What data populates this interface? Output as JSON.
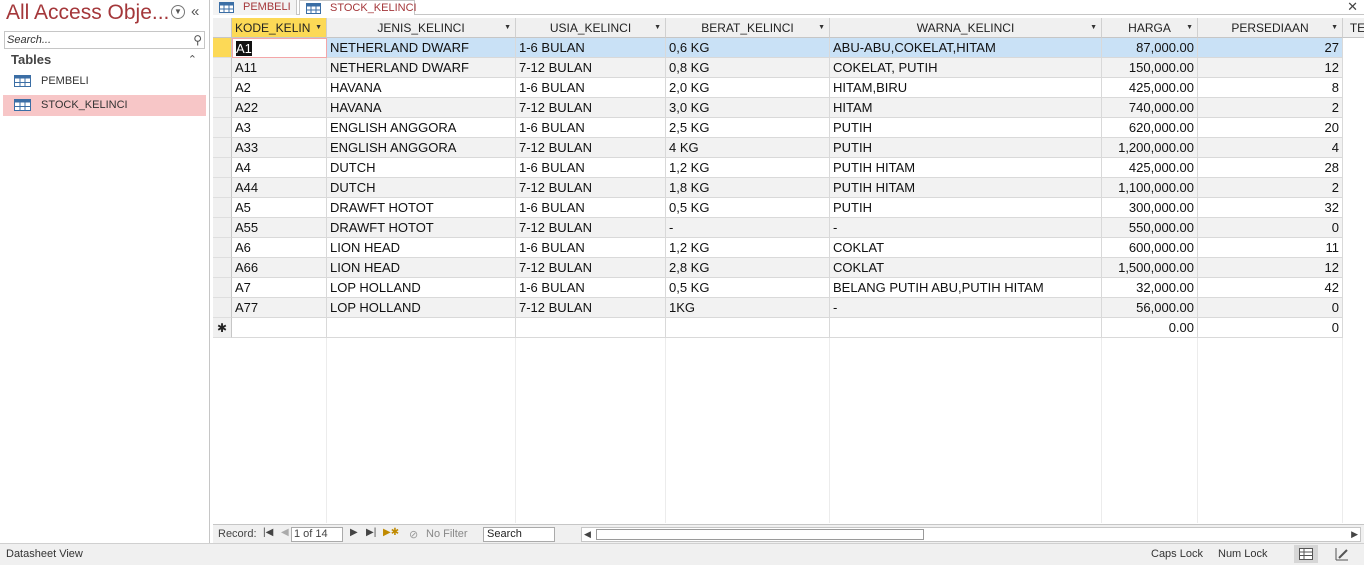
{
  "nav": {
    "title": "All Access Obje...",
    "search_placeholder": "Search...",
    "group_label": "Tables",
    "items": [
      {
        "label": "PEMBELI",
        "selected": false
      },
      {
        "label": "STOCK_KELINCI",
        "selected": true
      }
    ]
  },
  "tabs": [
    {
      "label": "PEMBELI",
      "active": false
    },
    {
      "label": "STOCK_KELINCI",
      "active": true
    }
  ],
  "grid": {
    "columns": [
      "KODE_KELIN",
      "JENIS_KELINCI",
      "USIA_KELINCI",
      "BERAT_KELINCI",
      "WARNA_KELINCI",
      "HARGA",
      "PERSEDIAAN",
      "TE"
    ],
    "rows": [
      [
        "A1",
        "NETHERLAND DWARF",
        "1-6 BULAN",
        "0,6 KG",
        "ABU-ABU,COKELAT,HITAM",
        "87,000.00",
        "27"
      ],
      [
        "A11",
        "NETHERLAND DWARF",
        "7-12 BULAN",
        "0,8 KG",
        "COKELAT, PUTIH",
        "150,000.00",
        "12"
      ],
      [
        "A2",
        "HAVANA",
        "1-6 BULAN",
        "2,0 KG",
        "HITAM,BIRU",
        "425,000.00",
        "8"
      ],
      [
        "A22",
        "HAVANA",
        "7-12 BULAN",
        "3,0 KG",
        "HITAM",
        "740,000.00",
        "2"
      ],
      [
        "A3",
        "ENGLISH ANGGORA",
        "1-6 BULAN",
        "2,5 KG",
        "PUTIH",
        "620,000.00",
        "20"
      ],
      [
        "A33",
        "ENGLISH ANGGORA",
        "7-12 BULAN",
        "4 KG",
        "PUTIH",
        "1,200,000.00",
        "4"
      ],
      [
        "A4",
        "DUTCH",
        "1-6 BULAN",
        "1,2 KG",
        "PUTIH HITAM",
        "425,000.00",
        "28"
      ],
      [
        "A44",
        "DUTCH",
        "7-12 BULAN",
        "1,8 KG",
        "PUTIH HITAM",
        "1,100,000.00",
        "2"
      ],
      [
        "A5",
        "DRAWFT HOTOT",
        "1-6 BULAN",
        "0,5 KG",
        "PUTIH",
        "300,000.00",
        "32"
      ],
      [
        "A55",
        "DRAWFT HOTOT",
        "7-12 BULAN",
        "-",
        "-",
        "550,000.00",
        "0"
      ],
      [
        "A6",
        "LION HEAD",
        "1-6 BULAN",
        "1,2 KG",
        "COKLAT",
        "600,000.00",
        "11"
      ],
      [
        "A66",
        "LION HEAD",
        "7-12 BULAN",
        "2,8 KG",
        "COKLAT",
        "1,500,000.00",
        "12"
      ],
      [
        "A7",
        "LOP HOLLAND",
        "1-6 BULAN",
        "0,5 KG",
        "BELANG PUTIH ABU,PUTIH HITAM",
        "32,000.00",
        "42"
      ],
      [
        "A77",
        "LOP HOLLAND",
        "7-12 BULAN",
        "1KG",
        "-",
        "56,000.00",
        "0"
      ]
    ],
    "new_row": {
      "marker": "✱",
      "harga": "0.00",
      "persediaan": "0"
    }
  },
  "record_bar": {
    "label": "Record:",
    "position": "1 of 14",
    "filter": "No Filter",
    "search": "Search"
  },
  "status": {
    "view": "Datasheet View",
    "caps": "Caps Lock",
    "num": "Num Lock"
  },
  "colors": {
    "accent": "#a4373a",
    "selected_row": "#c9e1f6",
    "active_header": "#fcd956",
    "nav_selected": "#f7c6c7"
  }
}
